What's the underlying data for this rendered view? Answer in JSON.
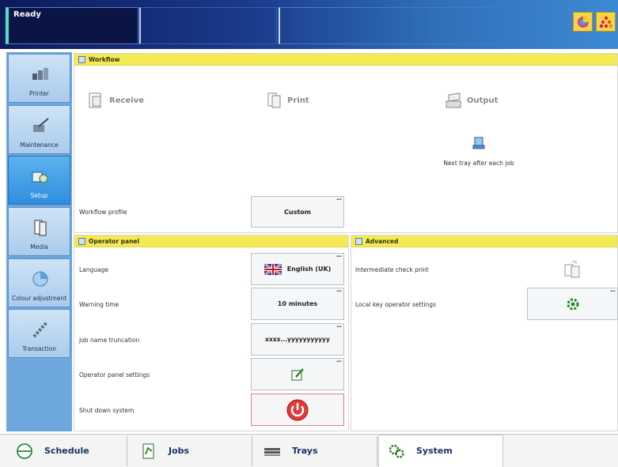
{
  "topbar": {
    "status": "Ready"
  },
  "sidebar": {
    "items": [
      {
        "label": "Printer"
      },
      {
        "label": "Maintenance"
      },
      {
        "label": "Setup"
      },
      {
        "label": "Media"
      },
      {
        "label": "Colour adjustment"
      },
      {
        "label": "Transaction"
      }
    ],
    "active": "Setup"
  },
  "workflow": {
    "title": "Workflow",
    "steps": [
      {
        "label": "Receive"
      },
      {
        "label": "Print"
      },
      {
        "label": "Output"
      }
    ],
    "next_tray": "Next tray after each job",
    "profile_label": "Workflow profile",
    "profile_value": "Custom"
  },
  "operator_panel": {
    "title": "Operator panel",
    "rows": [
      {
        "label": "Language",
        "value": "English (UK)"
      },
      {
        "label": "Warning time",
        "value": "10 minutes"
      },
      {
        "label": "Job name truncation",
        "value": "xxxx...yyyyyyyyyyy"
      },
      {
        "label": "Operator panel settings",
        "value": ""
      },
      {
        "label": "Shut down system",
        "value": ""
      }
    ]
  },
  "advanced": {
    "title": "Advanced",
    "rows": [
      {
        "label": "Intermediate check print"
      },
      {
        "label": "Local key operator settings"
      }
    ]
  },
  "tabs": [
    {
      "label": "Schedule"
    },
    {
      "label": "Jobs"
    },
    {
      "label": "Trays"
    },
    {
      "label": "System"
    }
  ],
  "colors": {
    "accent_yellow": "#f4ea54",
    "sidebar_blue": "#6ea7dd",
    "active_blue": "#2f8ede",
    "topbar_dark": "#0c1a5c"
  }
}
